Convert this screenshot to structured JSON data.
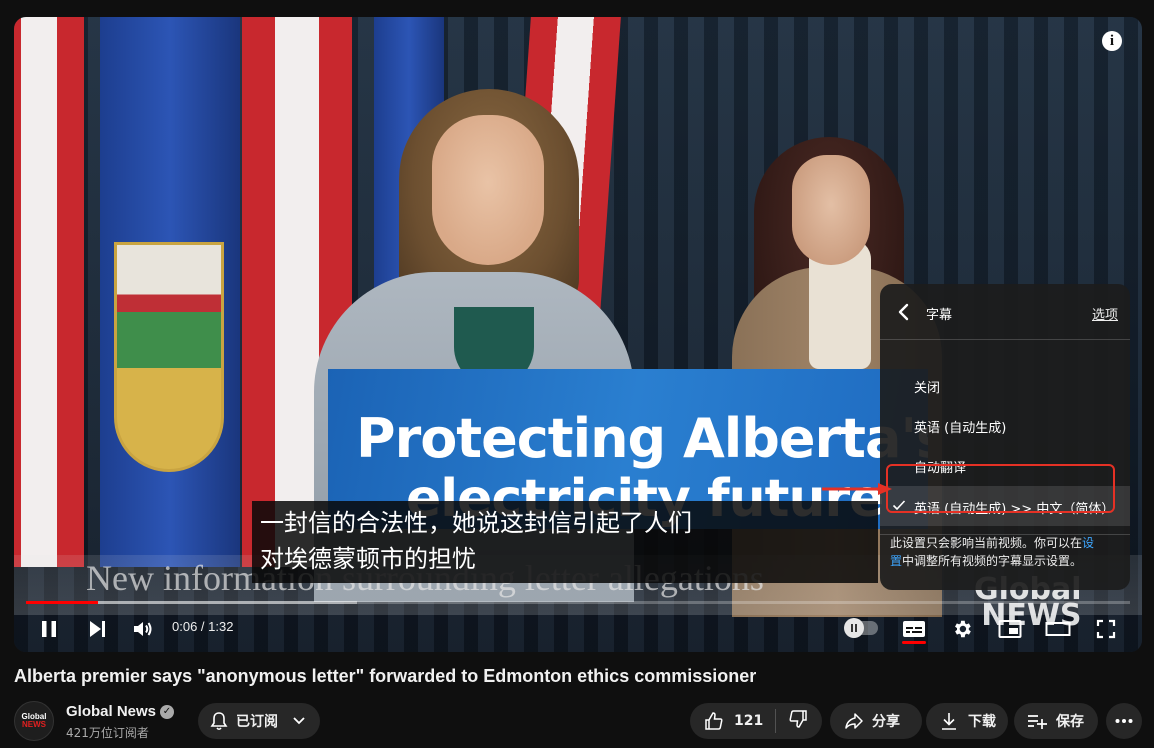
{
  "video": {
    "sign_line1": "Protecting Alberta's",
    "sign_line2": "electricity future",
    "lower_third": "New information surrounding letter allegations",
    "bug_line1": "Global",
    "bug_line2": "NEWS",
    "info_icon": "info-icon",
    "caption_lines": [
      "一封信的合法性，她说这封信引起了人们",
      "对埃德蒙顿市的担忧"
    ]
  },
  "player": {
    "time_current": "0:06",
    "time_total": "1:32",
    "time_display": "0:06 / 1:32",
    "progress_played_fraction": 0.065,
    "progress_buffered_fraction": 0.3,
    "autoplay_on": false,
    "captions_on": true
  },
  "subtitle_menu": {
    "title": "字幕",
    "options_link": "选项",
    "items": [
      {
        "label": "关闭",
        "selected": false
      },
      {
        "label": "英语 (自动生成)",
        "selected": false
      },
      {
        "label": "自动翻译",
        "selected": false
      },
      {
        "label": "英语 (自动生成) >> 中文（简体）",
        "selected": true
      }
    ],
    "note_text": "此设置只会影响当前视频。你可以在",
    "note_link1": "设",
    "note_link2": "置",
    "note_text2": "中调整所有视频的字幕显示设置。"
  },
  "video_title": "Alberta premier says \"anonymous letter\" forwarded to Edmonton ethics commissioner",
  "channel": {
    "name": "Global News",
    "subscribers": "421万位订阅者",
    "avatar_line1": "Global",
    "avatar_line2": "NEWS"
  },
  "actions": {
    "subscribed_label": "已订阅",
    "like_count": "121",
    "share_label": "分享",
    "download_label": "下载",
    "save_label": "保存"
  },
  "colors": {
    "progress_red": "#ff0000",
    "highlight_red": "#e53125",
    "link_blue": "#3ea6ff"
  }
}
